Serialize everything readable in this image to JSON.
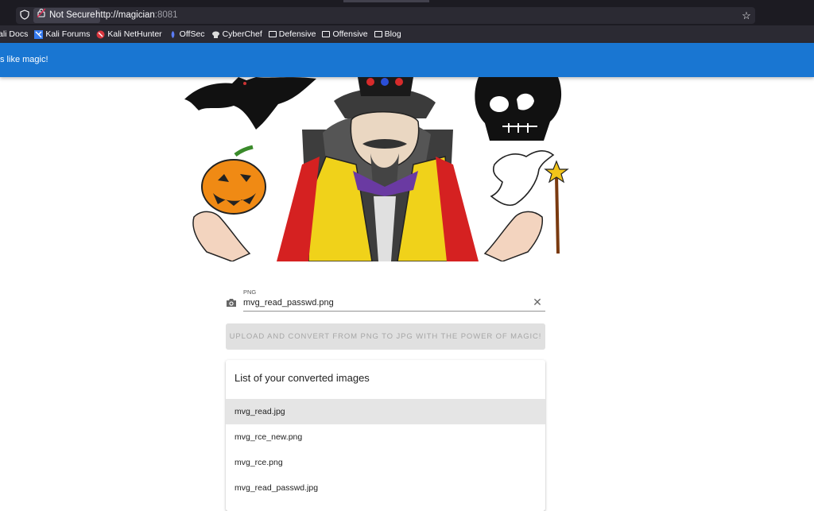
{
  "browser": {
    "security_label": "Not Secure",
    "url_host": "http://magician",
    "url_port": ":8081",
    "bookmarks": [
      {
        "label": "ali Docs",
        "icon": "kali-icon"
      },
      {
        "label": "Kali Forums",
        "icon": "kali-forums-icon"
      },
      {
        "label": "Kali NetHunter",
        "icon": "nethunter-icon"
      },
      {
        "label": "OffSec",
        "icon": "offsec-icon"
      },
      {
        "label": "CyberChef",
        "icon": "cyberchef-icon"
      },
      {
        "label": "Defensive",
        "icon": "folder-icon"
      },
      {
        "label": "Offensive",
        "icon": "folder-icon"
      },
      {
        "label": "Blog",
        "icon": "folder-icon"
      }
    ]
  },
  "appbar": {
    "title": "s like magic!",
    "color": "#1976d2"
  },
  "upload": {
    "field_label": "PNG",
    "file_name": "mvg_read_passwd.png",
    "button_label": "Upload and convert from PNG to JPG with the power of magic!"
  },
  "converted": {
    "title": "List of your converted images",
    "items": [
      "mvg_read.jpg",
      "mvg_rce_new.png",
      "mvg_rce.png",
      "mvg_read_passwd.jpg"
    ]
  }
}
